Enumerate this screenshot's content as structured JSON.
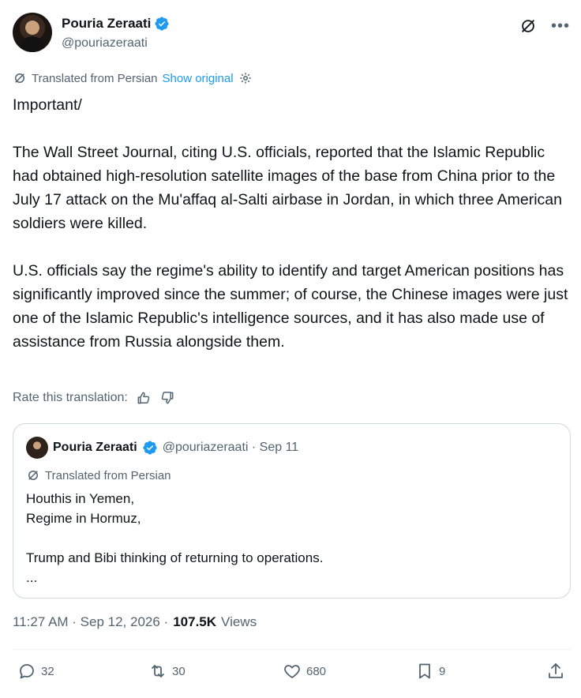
{
  "author": {
    "name": "Pouria Zeraati",
    "handle": "@pouriazeraati"
  },
  "translation_bar": {
    "label": "Translated from Persian",
    "show_original": "Show original"
  },
  "post_text": "Important/\n\nThe Wall Street Journal, citing U.S. officials, reported that the Islamic Republic had obtained high-resolution satellite images of the base from China prior to the July 17 attack on the Mu'affaq al-Salti airbase in Jordan, in which three American soldiers were killed.\n\nU.S. officials say the regime's ability to identify and target American positions has significantly improved since the summer; of course, the Chinese images were just one of the Islamic Republic's intelligence sources, and it has also made use of assistance from Russia alongside them.",
  "rate_translation": "Rate this translation:",
  "quoted_post": {
    "name": "Pouria Zeraati",
    "handle_date": "@pouriazeraati · Sep 11",
    "translated_label": "Translated from Persian",
    "text": "Houthis in Yemen,\nRegime in Hormuz,\n\nTrump and Bibi thinking of returning to operations.\n..."
  },
  "timestamp": "11:27 AM · Sep 12, 2026 ·",
  "views_count": "107.5K",
  "views_label": "Views",
  "actions": {
    "replies": "32",
    "reposts": "30",
    "likes": "680",
    "bookmarks": "9"
  },
  "colors": {
    "accent": "#1d9bf0",
    "secondary_text": "#536471",
    "primary_text": "#0f1419",
    "border": "#cfd9de"
  }
}
